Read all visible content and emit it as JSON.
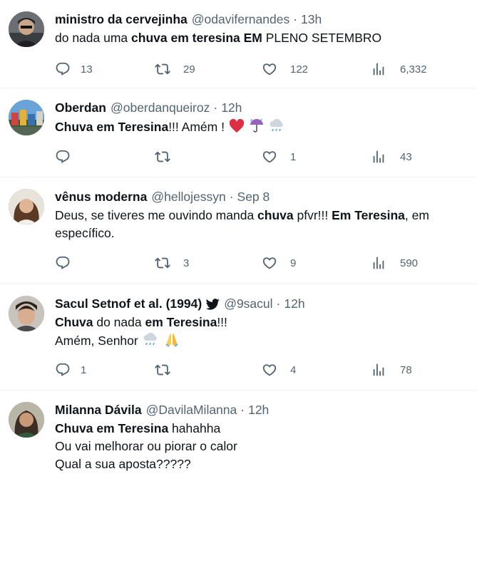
{
  "tweets": [
    {
      "name": "ministro da cervejinha",
      "handle": "@odavifernandes",
      "time": "13h",
      "text": [
        "do nada uma ",
        "chuva em teresina EM",
        " PLENO SETEMBRO"
      ],
      "replies": "13",
      "retweets": "29",
      "likes": "122",
      "views": "6,332"
    },
    {
      "name": "Oberdan",
      "handle": "@oberdanqueiroz",
      "time": "12h",
      "text": [
        "Chuva em Teresina",
        "!!! Amém !"
      ],
      "emoji": [
        "heart-emoji",
        "umbrella-rain-emoji",
        "rain-cloud-emoji"
      ],
      "replies": "",
      "retweets": "",
      "likes": "1",
      "views": "43"
    },
    {
      "name": "vênus moderna",
      "handle": "@hellojessyn",
      "time": "Sep 8",
      "text": [
        "Deus, se tiveres me ouvindo manda ",
        "chuva",
        " pfvr!!! ",
        "Em Teresina",
        ", em",
        "específico."
      ],
      "replies": "",
      "retweets": "3",
      "likes": "9",
      "views": "590"
    },
    {
      "name": "Sacul Setnof et al. (1994)",
      "handle": "@9sacul",
      "time": "12h",
      "text": [
        "Chuva",
        " do nada ",
        "em Teresina",
        "!!!",
        "Amém, Senhor"
      ],
      "emoji": [
        "rain-cloud-emoji",
        "praying-hands-emoji"
      ],
      "replies": "1",
      "retweets": "",
      "likes": "4",
      "views": "78"
    },
    {
      "name": "Milanna Dávila",
      "handle": "@DavilaMilanna",
      "time": "12h",
      "text": [
        "Chuva em Teresina",
        " hahahha",
        "Ou vai melhorar ou piorar o calor",
        "Qual a sua aposta?????"
      ]
    }
  ],
  "separator": "·",
  "colors": {
    "text": "#0f1419",
    "secondary": "#536471",
    "divider": "#eff3f4",
    "heart": "#e0245e"
  }
}
